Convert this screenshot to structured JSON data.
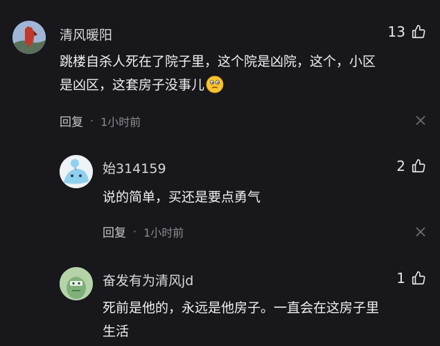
{
  "comments": [
    {
      "name": "清风暖阳",
      "likes": "13",
      "line1": "跳楼自杀人死在了院子里，这个院是凶院，这个，小区",
      "line2": "是凶区，这套房子没事儿",
      "emoji": "thinking-face-icon",
      "reply_label": "回复",
      "dot": "·",
      "time": "1小时前"
    },
    {
      "name": "始314159",
      "likes": "2",
      "line1": "说的简单，买还是要点勇气",
      "reply_label": "回复",
      "dot": "·",
      "time": "1小时前"
    },
    {
      "name": "奋发有为清风jd",
      "likes": "1",
      "line1": "死前是他的，永远是他房子。一直会在这房子里",
      "line2": "生活"
    }
  ],
  "colors": {
    "background": "#17171c",
    "text": "#f0f0f2",
    "meta": "#8b8b92"
  }
}
